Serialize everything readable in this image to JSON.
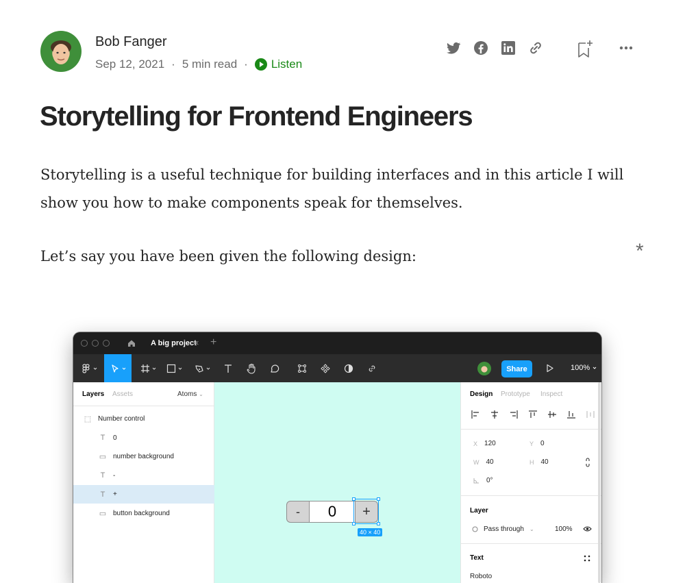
{
  "author": {
    "name": "Bob Fanger",
    "date": "Sep 12, 2021",
    "read_time": "5 min read",
    "separator": "·",
    "listen_label": "Listen"
  },
  "share": {
    "icons": [
      "twitter-icon",
      "facebook-icon",
      "linkedin-icon",
      "link-icon"
    ],
    "bookmark_icon": "bookmark-add-icon",
    "more_icon": "more-options-icon"
  },
  "article": {
    "title": "Storytelling for Frontend Engineers",
    "paragraph1": "Storytelling is a useful technique for building interfaces and in this article I will show you how to make components speak for themselves.",
    "paragraph2": "Let’s say you have been given the following design:",
    "asterisk": "*"
  },
  "figma": {
    "tab_title": "A big project",
    "tab_close": "×",
    "tab_add": "+",
    "share_label": "Share",
    "zoom": "100%",
    "left_tabs": [
      "Layers",
      "Assets"
    ],
    "page_selector": "Atoms",
    "layers": [
      {
        "icon": "frame-icon",
        "glyph": "⬚",
        "name": "Number control",
        "indent": false,
        "selected": false
      },
      {
        "icon": "text-icon",
        "glyph": "T",
        "name": "0",
        "indent": true,
        "selected": false
      },
      {
        "icon": "rectangle-icon",
        "glyph": "▭",
        "name": "number background",
        "indent": true,
        "selected": false
      },
      {
        "icon": "text-icon",
        "glyph": "T",
        "name": "-",
        "indent": true,
        "selected": false
      },
      {
        "icon": "text-icon",
        "glyph": "T",
        "name": "+",
        "indent": true,
        "selected": true
      },
      {
        "icon": "rectangle-icon",
        "glyph": "▭",
        "name": "button background",
        "indent": true,
        "selected": false
      }
    ],
    "canvas": {
      "minus_label": "-",
      "value": "0",
      "plus_label": "+",
      "dimension_badge": "40 × 40"
    },
    "right_tabs": [
      "Design",
      "Prototype",
      "Inspect"
    ],
    "props": {
      "x_label": "X",
      "x": "120",
      "y_label": "Y",
      "y": "0",
      "w_label": "W",
      "w": "40",
      "h_label": "H",
      "h": "40",
      "rotation_icon": "rotation-icon",
      "rotation": "0°"
    },
    "layer_section": {
      "title": "Layer",
      "blend": "Pass through",
      "opacity": "100%"
    },
    "text_section": {
      "title": "Text",
      "font": "Roboto"
    },
    "colors": {
      "accent": "#18a0fb",
      "canvas": "#cffcf2",
      "listen_green": "#1a8917"
    }
  }
}
